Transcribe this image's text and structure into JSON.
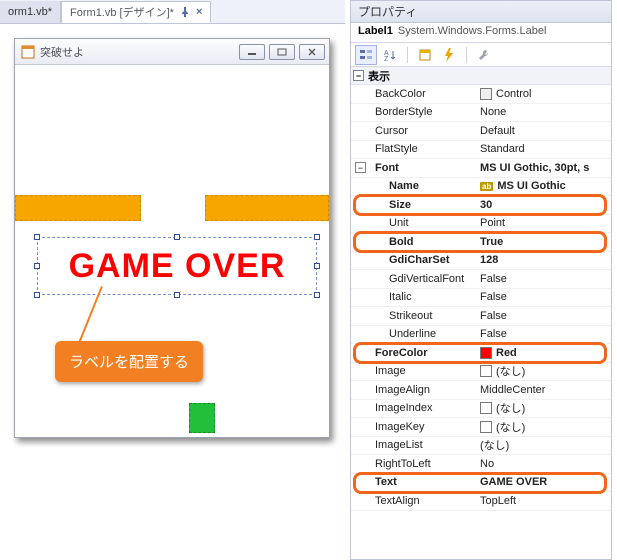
{
  "tabs": [
    {
      "label": "orm1.vb*",
      "active": false
    },
    {
      "label": "Form1.vb [デザイン]*",
      "active": true
    }
  ],
  "form": {
    "title": "突破せよ",
    "label_text": "GAME  OVER"
  },
  "callout": "ラベルを配置する",
  "properties_panel": {
    "title": "プロパティ",
    "selected_name": "Label1",
    "selected_class": "System.Windows.Forms.Label",
    "section": "表示",
    "rows": [
      {
        "name": "BackColor",
        "value": "Control",
        "swatch": "control"
      },
      {
        "name": "BorderStyle",
        "value": "None"
      },
      {
        "name": "Cursor",
        "value": "Default"
      },
      {
        "name": "FlatStyle",
        "value": "Standard"
      },
      {
        "name": "Font",
        "value": "MS UI Gothic, 30pt, s",
        "bold": true,
        "expandable": true
      },
      {
        "name": "Name",
        "value": "MS UI Gothic",
        "indent": true,
        "bold": true,
        "ab": true
      },
      {
        "name": "Size",
        "value": "30",
        "indent": true,
        "bold": true,
        "hl": "hl-size"
      },
      {
        "name": "Unit",
        "value": "Point",
        "indent": true
      },
      {
        "name": "Bold",
        "value": "True",
        "indent": true,
        "bold": true,
        "hl": "hl-bold"
      },
      {
        "name": "GdiCharSet",
        "value": "128",
        "indent": true,
        "bold": true
      },
      {
        "name": "GdiVerticalFont",
        "value": "False",
        "indent": true
      },
      {
        "name": "Italic",
        "value": "False",
        "indent": true
      },
      {
        "name": "Strikeout",
        "value": "False",
        "indent": true
      },
      {
        "name": "Underline",
        "value": "False",
        "indent": true
      },
      {
        "name": "ForeColor",
        "value": "Red",
        "swatch": "red",
        "bold": true,
        "hl": "hl-fore"
      },
      {
        "name": "Image",
        "value": "(なし)",
        "swatch": "empty"
      },
      {
        "name": "ImageAlign",
        "value": "MiddleCenter"
      },
      {
        "name": "ImageIndex",
        "value": "(なし)",
        "swatch": "empty"
      },
      {
        "name": "ImageKey",
        "value": "(なし)",
        "swatch": "empty"
      },
      {
        "name": "ImageList",
        "value": "(なし)"
      },
      {
        "name": "RightToLeft",
        "value": "No"
      },
      {
        "name": "Text",
        "value": "GAME  OVER",
        "bold": true,
        "hl": "hl-text"
      },
      {
        "name": "TextAlign",
        "value": "TopLeft"
      }
    ]
  }
}
